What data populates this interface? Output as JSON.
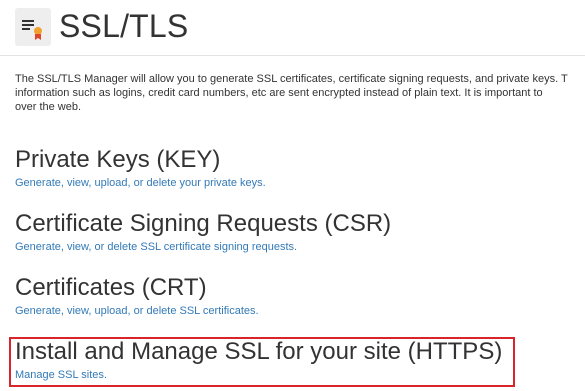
{
  "page": {
    "title": "SSL/TLS",
    "icon": "ssl-certificate-icon",
    "description_line1": "The SSL/TLS Manager will allow you to generate SSL certificates, certificate signing requests, and private keys. T",
    "description_line2": "information such as logins, credit card numbers, etc are sent encrypted instead of plain text. It is important to",
    "description_line3": "over the web."
  },
  "sections": {
    "private_keys": {
      "heading": "Private Keys (KEY)",
      "link": "Generate, view, upload, or delete your private keys."
    },
    "csr": {
      "heading": "Certificate Signing Requests (CSR)",
      "link": "Generate, view, or delete SSL certificate signing requests."
    },
    "certificates": {
      "heading": "Certificates (CRT)",
      "link": "Generate, view, upload, or delete SSL certificates."
    },
    "install": {
      "heading": "Install and Manage SSL for your site (HTTPS)",
      "link": "Manage SSL sites."
    }
  },
  "colors": {
    "link": "#337ab7",
    "highlight": "#d9242b",
    "text": "#333333"
  }
}
